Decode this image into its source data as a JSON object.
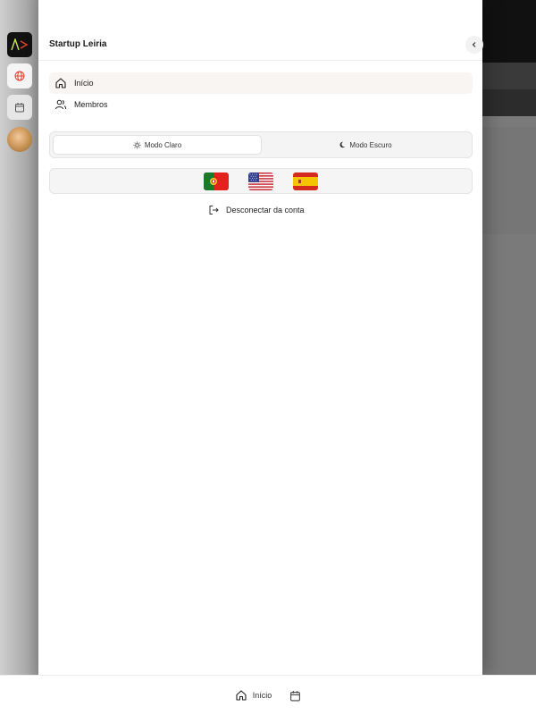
{
  "sidebar_rail": {
    "logo": "app-logo",
    "items": [
      {
        "icon": "globe-icon",
        "active": true
      },
      {
        "icon": "calendar-icon",
        "active": false
      }
    ],
    "avatar": "user-avatar"
  },
  "drawer": {
    "title": "Startup Leiria",
    "nav": [
      {
        "label": "Início",
        "icon": "home-icon",
        "active": true
      },
      {
        "label": "Membros",
        "icon": "users-icon",
        "active": false
      }
    ],
    "theme": {
      "light_label": "Modo Claro",
      "dark_label": "Modo Escuro",
      "selected": "light"
    },
    "languages": [
      {
        "name": "Português",
        "icon": "flag-portugal-icon"
      },
      {
        "name": "English",
        "icon": "flag-usa-icon"
      },
      {
        "name": "Español",
        "icon": "flag-spain-icon"
      }
    ],
    "logout_label": "Desconectar da conta"
  },
  "bottom_bar": {
    "home_label": "Início"
  },
  "colors": {
    "accent": "#e8402a",
    "active_nav_bg": "#f8f5f2",
    "overlay": "#7a7a7a"
  }
}
